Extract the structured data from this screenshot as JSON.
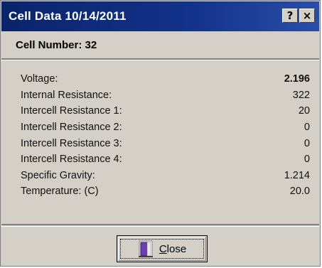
{
  "window": {
    "title": "Cell Data 10/14/2011",
    "help_button": "?",
    "close_button": "×"
  },
  "header": {
    "cell_number": "Cell Number:  32"
  },
  "rows": [
    {
      "label": "Voltage:",
      "value": "2.196"
    },
    {
      "label": "Internal Resistance:",
      "value": "322"
    },
    {
      "label": "Intercell Resistance 1:",
      "value": "20"
    },
    {
      "label": "Intercell Resistance 2:",
      "value": "0"
    },
    {
      "label": "Intercell Resistance 3:",
      "value": "0"
    },
    {
      "label": "Intercell Resistance 4:",
      "value": "0"
    },
    {
      "label": "Specific Gravity:",
      "value": "1.214"
    },
    {
      "label": "Temperature:  (C)",
      "value": "20.0"
    }
  ],
  "footer": {
    "close_mnemonic": "C",
    "close_rest": "lose",
    "close_icon": "door-exit-icon"
  }
}
